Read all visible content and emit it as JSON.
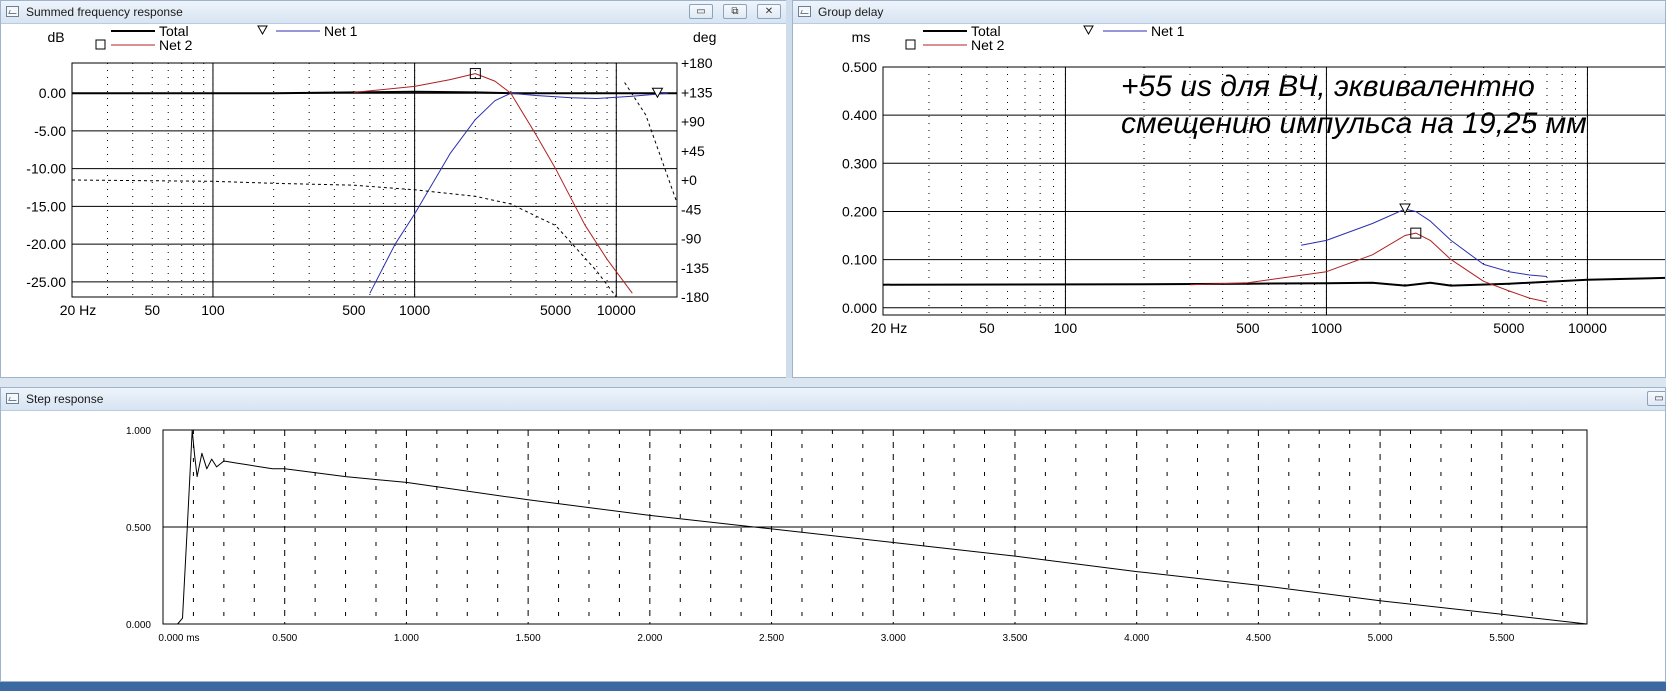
{
  "windows": {
    "freq": {
      "title": "Summed frequency response"
    },
    "gd": {
      "title": "Group delay"
    },
    "step": {
      "title": "Step response"
    }
  },
  "titlebar_buttons": {
    "minimize": "▭",
    "restore": "⧉",
    "close": "✕"
  },
  "freq_chart": {
    "type": "line",
    "left_unit": "dB",
    "right_unit": "deg",
    "legend": [
      {
        "name": "Total",
        "marker": "none"
      },
      {
        "name": "Net 1",
        "marker": "triangle"
      },
      {
        "name": "Net 2",
        "marker": "square"
      }
    ],
    "y_ticks": [
      "0.00",
      "-5.00",
      "-10.00",
      "-15.00",
      "-20.00",
      "-25.00"
    ],
    "right_ticks": [
      "+180",
      "+135",
      "+90",
      "+45",
      "+0",
      "-45",
      "-90",
      "-135",
      "-180"
    ],
    "x_ticks": [
      "20 Hz",
      "50",
      "100",
      "500",
      "1000",
      "5000",
      "10000"
    ]
  },
  "gd_chart": {
    "type": "line",
    "left_unit": "ms",
    "legend": [
      {
        "name": "Total",
        "marker": "none"
      },
      {
        "name": "Net 1",
        "marker": "triangle"
      },
      {
        "name": "Net 2",
        "marker": "square"
      }
    ],
    "y_ticks": [
      "0.500",
      "0.400",
      "0.300",
      "0.200",
      "0.100",
      "0.000"
    ],
    "x_ticks": [
      "20 Hz",
      "50",
      "100",
      "500",
      "1000",
      "5000",
      "10000"
    ],
    "annotation_lines": [
      "+55 us для ВЧ, эквивалентно",
      "смещению импульса на 19,25 мм"
    ]
  },
  "step_chart": {
    "type": "line",
    "y_ticks": [
      "1.000",
      "0.500",
      "0.000"
    ],
    "x_ticks": [
      "0.000 ms",
      "0.500",
      "1.000",
      "1.500",
      "2.000",
      "2.500",
      "3.000",
      "3.500",
      "4.000",
      "4.500",
      "5.000",
      "5.500"
    ]
  },
  "chart_data": [
    {
      "type": "line",
      "title": "Summed frequency response",
      "x_scale": "log",
      "xlim": [
        20,
        20000
      ],
      "ylim": [
        -27,
        4
      ],
      "y2lim": [
        -180,
        180
      ],
      "series": [
        {
          "name": "Total",
          "axis": "dB",
          "x": [
            20,
            200,
            500,
            1000,
            2000,
            3000,
            5000,
            8000,
            12000,
            20000
          ],
          "y": [
            0,
            0,
            0.1,
            0.2,
            0.1,
            0,
            0,
            0,
            0,
            0
          ]
        },
        {
          "name": "Net 1",
          "axis": "dB",
          "x": [
            600,
            800,
            1000,
            1500,
            2000,
            2500,
            3000,
            4000,
            6000,
            8000,
            12000,
            18000
          ],
          "y": [
            -26.5,
            -20,
            -16,
            -8,
            -3.5,
            -1,
            0,
            -0.3,
            -0.6,
            -0.7,
            -0.4,
            0
          ]
        },
        {
          "name": "Net 2",
          "axis": "dB",
          "x": [
            500,
            1000,
            1500,
            2000,
            2500,
            3000,
            4000,
            5000,
            7000,
            9000,
            12000
          ],
          "y": [
            0.1,
            0.9,
            1.8,
            2.6,
            1.6,
            0,
            -5.5,
            -10,
            -17.5,
            -22,
            -26.5
          ]
        },
        {
          "name": "Phase",
          "axis": "deg",
          "x": [
            20,
            100,
            200,
            500,
            1000,
            2000,
            3000,
            5000,
            8000,
            10000,
            11000,
            14000,
            20000
          ],
          "y": [
            0,
            -2,
            -5,
            -8,
            -15,
            -25,
            -37,
            -70,
            -140,
            -180,
            150,
            100,
            -35
          ]
        }
      ],
      "markers": [
        {
          "series": "Net 2",
          "shape": "square",
          "x": 2000,
          "y": 2.6
        },
        {
          "series": "Net 1",
          "shape": "triangle",
          "x": 16000,
          "y": 0
        }
      ]
    },
    {
      "type": "line",
      "title": "Group delay",
      "x_scale": "log",
      "xlim": [
        20,
        20000
      ],
      "ylim": [
        -0.015,
        0.5
      ],
      "series": [
        {
          "name": "Total",
          "x": [
            20,
            200,
            500,
            1000,
            1500,
            2000,
            2500,
            3000,
            5000,
            10000,
            20000
          ],
          "y": [
            0.048,
            0.049,
            0.05,
            0.051,
            0.052,
            0.046,
            0.052,
            0.046,
            0.05,
            0.058,
            0.062
          ]
        },
        {
          "name": "Net 1",
          "x": [
            800,
            1000,
            1500,
            2000,
            2200,
            2500,
            3000,
            4000,
            5000,
            6000,
            7000
          ],
          "y": [
            0.13,
            0.14,
            0.175,
            0.205,
            0.2,
            0.18,
            0.14,
            0.09,
            0.075,
            0.068,
            0.065
          ]
        },
        {
          "name": "Net 2",
          "x": [
            300,
            500,
            1000,
            1500,
            2000,
            2200,
            2500,
            3000,
            4000,
            5000,
            6000,
            7000
          ],
          "y": [
            0.048,
            0.052,
            0.075,
            0.11,
            0.15,
            0.155,
            0.14,
            0.1,
            0.055,
            0.035,
            0.02,
            0.012
          ]
        }
      ],
      "markers": [
        {
          "series": "Net 1",
          "shape": "triangle",
          "x": 2000,
          "y": 0.205
        },
        {
          "series": "Net 2",
          "shape": "square",
          "x": 2200,
          "y": 0.155
        }
      ]
    },
    {
      "type": "line",
      "title": "Step response",
      "xlim": [
        0,
        5.85
      ],
      "ylim": [
        0,
        1
      ],
      "series": [
        {
          "name": "Step",
          "x": [
            0.06,
            0.08,
            0.1,
            0.12,
            0.13,
            0.14,
            0.16,
            0.18,
            0.2,
            0.22,
            0.25,
            0.3,
            0.35,
            0.4,
            0.45,
            0.5,
            0.75,
            1.0,
            1.5,
            2.0,
            2.5,
            3.0,
            3.5,
            4.0,
            4.5,
            5.0,
            5.5,
            5.85
          ],
          "y": [
            0.0,
            0.03,
            0.5,
            1.0,
            0.87,
            0.76,
            0.88,
            0.8,
            0.85,
            0.81,
            0.84,
            0.83,
            0.82,
            0.81,
            0.8,
            0.8,
            0.76,
            0.73,
            0.64,
            0.56,
            0.49,
            0.42,
            0.35,
            0.27,
            0.2,
            0.12,
            0.05,
            0.0
          ]
        }
      ]
    }
  ],
  "colors": {
    "total": "#000000",
    "net1": "#2b2fb0",
    "net2": "#b02020",
    "phase": "#000000",
    "grid": "#000000"
  }
}
